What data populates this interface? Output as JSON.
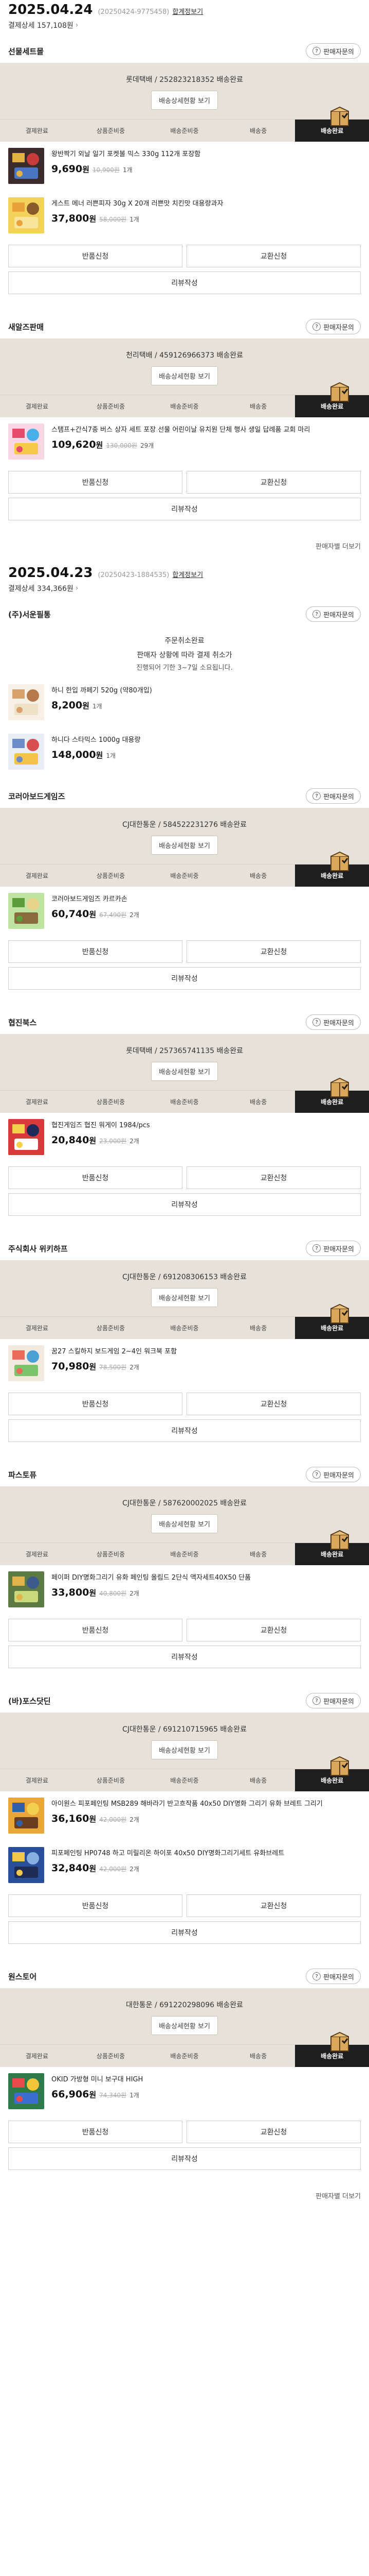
{
  "labels": {
    "detail": "결제상세",
    "inquiry": "판매자문의",
    "ship_info": "배송상세현황 보기",
    "exchange": "교환신청",
    "return": "반품신청",
    "review": "리뷰작성",
    "more_items": "판매자별 더보기",
    "count_suffix": "개",
    "currency": "원"
  },
  "steps": [
    "결제완료",
    "상품준비중",
    "배송준비중",
    "배송중",
    "배송완료"
  ],
  "orders": [
    {
      "date": "2025.04.24",
      "order_no": "(20250424-9775458)",
      "summary_link": "합계정보기",
      "detail_amount": "결제상세 157,108원",
      "vendors": [
        {
          "name": "선물세트몰",
          "status": "롯데택배 / 252823218352 배송완료",
          "notice": null,
          "products": [
            {
              "thumb": "choco",
              "name": "왕반짝기 외날 일기 포켓볼 믹스 330g 112개 포장함",
              "price": "9,690",
              "orig": "10,900원",
              "qty": "1개"
            },
            {
              "thumb": "box",
              "name": "게스트 메너 러쁜피자 30g X 20개 러쁜맛 치킨맛 대용량과자",
              "price": "37,800",
              "orig": "58,000원",
              "qty": "1개"
            }
          ]
        },
        {
          "name": "새알즈판매",
          "status": "천리택배 / 459126966373 배송완료",
          "notice": null,
          "products": [
            {
              "thumb": "toys",
              "name": "스탬프+간식7종 버스 상자 세트 포장 선물 어린이날 유치원 단체 행사 생일 답례품 교회 마리",
              "price": "109,620",
              "orig": "130,000원",
              "qty": "29개"
            }
          ]
        }
      ]
    },
    {
      "date": "2025.04.23",
      "order_no": "(20250423-1884535)",
      "summary_link": "합계정보기",
      "detail_amount": "결제상세 334,366원",
      "vendors": [
        {
          "name": "(주)서운필통",
          "status": "주문취소완료",
          "notice": {
            "n1": "주문취소완료",
            "n2": "판매자 상황에 따라 결제 취소가",
            "n3": "진행되어 기한 3~7일 소요됩니다."
          },
          "products": [
            {
              "thumb": "candy",
              "name": "하니 한입 까페기 520g (약80개입)",
              "price": "8,200",
              "orig": "",
              "qty": "1개"
            },
            {
              "thumb": "jar",
              "name": "하니다 스타믹스 1000g 대용량",
              "price": "148,000",
              "orig": "",
              "qty": "1개"
            }
          ]
        },
        {
          "name": "코러아보드게임즈",
          "status": "CJ대한통운 / 584522231276 배송완료",
          "notice": null,
          "products": [
            {
              "thumb": "game",
              "name": "코러아보드게임즈 카르카손",
              "price": "60,740",
              "orig": "67,490원",
              "qty": "2개"
            }
          ]
        },
        {
          "name": "협진북스",
          "status": "롯데택배 / 257365741135 배송완료",
          "notice": null,
          "products": [
            {
              "thumb": "red",
              "name": "협진게임즈 협진 워게이 1984/pcs",
              "price": "20,840",
              "orig": "23,000원",
              "qty": "2개"
            }
          ]
        },
        {
          "name": "주식회사 위키하프",
          "status": "CJ대한통운 / 691208306153 배송완료",
          "notice": null,
          "products": [
            {
              "thumb": "kids",
              "name": "꿈27 스킬하지 보드게임 2~4인 워크북 포함",
              "price": "70,980",
              "orig": "78,500원",
              "qty": "2개"
            }
          ]
        },
        {
          "name": "파스토퓨",
          "status": "CJ대한통운 / 587620002025 배송완료",
          "notice": null,
          "products": [
            {
              "thumb": "paint",
              "name": "페이퍼 DIY명화그리기 유화 페인팅 올림드 2단식 액자세트40X50 단품",
              "price": "33,800",
              "orig": "40,800원",
              "qty": "2개"
            }
          ]
        },
        {
          "name": "(바)포스닷딘",
          "status": "CJ대한통운 / 691210715965 배송완료",
          "notice": null,
          "products": [
            {
              "thumb": "flower",
              "name": "아이원스 피포페인팅 MSB289 해바라기 반고흐작품 40x50 DIY명화 그리기 유화 브레트 그리기",
              "price": "36,160",
              "orig": "42,000원",
              "qty": "2개"
            },
            {
              "thumb": "sky",
              "name": "피포페인팅 HP0748 하고 미릴리온 하이포 40x50 DIY명화그리기세트 유화브레트",
              "price": "32,840",
              "orig": "42,000원",
              "qty": "2개"
            }
          ]
        },
        {
          "name": "원스토어",
          "status": "대한통운 / 691220298096 배송완료",
          "notice": null,
          "products": [
            {
              "thumb": "blocks",
              "name": "OKID 가방형 미니 보구대 HIGH",
              "price": "66,906",
              "orig": "74,340원",
              "qty": "1개"
            }
          ]
        }
      ]
    }
  ]
}
